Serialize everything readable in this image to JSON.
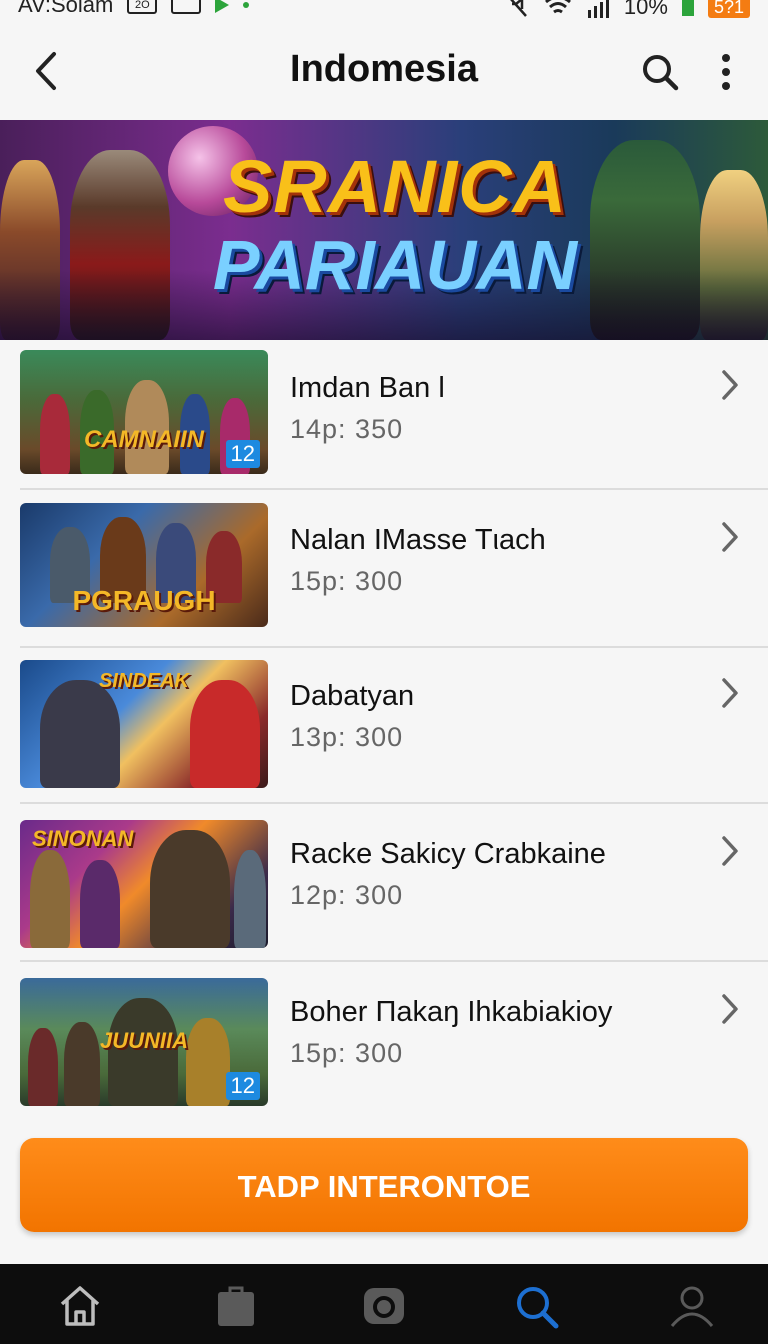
{
  "status_bar": {
    "time_text": "AV:Solam",
    "box_text": "2O",
    "battery": "10%",
    "badge": "5?1"
  },
  "header": {
    "title": "Indomesia"
  },
  "banner": {
    "line1": "SRANICA",
    "line2": "PARIAUAN"
  },
  "items": [
    {
      "name": "Imdan Ban l",
      "sub": "14p: 350",
      "thumb_label": "CAMNAIIN",
      "badge": "12"
    },
    {
      "name": "Nalan IMasse Tιach",
      "sub": "15p: 300",
      "thumb_label": "PGRAUGH",
      "badge": ""
    },
    {
      "name": "Dabatyan",
      "sub": "13p: 300",
      "thumb_label": "SINDEAK",
      "badge": ""
    },
    {
      "name": "Racke Sakicy Crabkaine",
      "sub": "12p: 300",
      "thumb_label": "SINONAN",
      "badge": ""
    },
    {
      "name": "Boher Πakaŋ Ihkabiakioy",
      "sub": "15p: 300",
      "thumb_label": "JUUNIIA",
      "badge": "12"
    }
  ],
  "cta": {
    "label": "TADP INTERONTOE"
  },
  "colors": {
    "accent": "#f27400",
    "active_nav": "#1d6fd1",
    "nav_bg": "#0d0d0d"
  },
  "bottom_nav": [
    {
      "icon": "home-icon",
      "active": false
    },
    {
      "icon": "shop-bag-icon",
      "active": false
    },
    {
      "icon": "camera-icon",
      "active": false
    },
    {
      "icon": "search-icon",
      "active": true
    },
    {
      "icon": "profile-icon",
      "active": false
    }
  ]
}
